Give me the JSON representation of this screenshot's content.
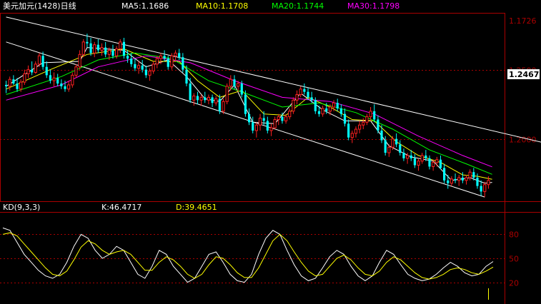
{
  "header": {
    "title": "美元加元(1428)日线",
    "ma": [
      {
        "label": "MA5:1.1686",
        "color": "#ffffff"
      },
      {
        "label": "MA10:1.1708",
        "color": "#ffff00"
      },
      {
        "label": "MA20:1.1744",
        "color": "#00ff00"
      },
      {
        "label": "MA30:1.1798",
        "color": "#ff00ff"
      }
    ]
  },
  "kd_header": {
    "name": "KD(9,3,3)",
    "k_label": "K:46.4717",
    "d_label": "D:39.4651"
  },
  "price_axis": {
    "top_value": "1.1726",
    "ticks": [
      "1.2500",
      "1.2000"
    ],
    "current_price": "1.2467",
    "current_price_display": "1.2467"
  },
  "kd_axis": {
    "ticks": [
      "80",
      "50",
      "20"
    ]
  },
  "colors": {
    "background": "#000000",
    "frame": "#aa0000",
    "grid": "#aa0000",
    "up_candle": "#ff2020",
    "down_candle": "#00ffff",
    "channel": "#ffffff",
    "k_line": "#ffffff",
    "d_line": "#ffff00"
  },
  "chart_data": [
    {
      "type": "candlestick",
      "title": "美元加元(1428)日线",
      "ylim": [
        1.156,
        1.29
      ],
      "gridlines": [
        1.25,
        1.2
      ],
      "channel": {
        "upper": [
          [
            0,
            1.288
          ],
          [
            148,
            1.196
          ]
        ],
        "lower": [
          [
            0,
            1.27
          ],
          [
            130,
            1.158
          ]
        ]
      },
      "candles": [
        [
          1.239,
          1.242,
          1.233,
          1.238
        ],
        [
          1.238,
          1.245,
          1.235,
          1.243
        ],
        [
          1.243,
          1.246,
          1.239,
          1.24
        ],
        [
          1.24,
          1.244,
          1.234,
          1.236
        ],
        [
          1.236,
          1.243,
          1.234,
          1.241
        ],
        [
          1.241,
          1.25,
          1.239,
          1.247
        ],
        [
          1.247,
          1.253,
          1.244,
          1.25
        ],
        [
          1.25,
          1.256,
          1.246,
          1.248
        ],
        [
          1.248,
          1.256,
          1.247,
          1.254
        ],
        [
          1.254,
          1.262,
          1.252,
          1.26
        ],
        [
          1.26,
          1.263,
          1.25,
          1.252
        ],
        [
          1.252,
          1.256,
          1.244,
          1.246
        ],
        [
          1.246,
          1.25,
          1.24,
          1.242
        ],
        [
          1.242,
          1.248,
          1.238,
          1.244
        ],
        [
          1.244,
          1.247,
          1.238,
          1.24
        ],
        [
          1.24,
          1.243,
          1.236,
          1.238
        ],
        [
          1.238,
          1.242,
          1.234,
          1.236
        ],
        [
          1.236,
          1.242,
          1.234,
          1.239
        ],
        [
          1.239,
          1.248,
          1.237,
          1.246
        ],
        [
          1.246,
          1.254,
          1.244,
          1.252
        ],
        [
          1.252,
          1.264,
          1.25,
          1.261
        ],
        [
          1.261,
          1.272,
          1.259,
          1.27
        ],
        [
          1.27,
          1.276,
          1.266,
          1.269
        ],
        [
          1.269,
          1.273,
          1.26,
          1.262
        ],
        [
          1.262,
          1.27,
          1.259,
          1.268
        ],
        [
          1.268,
          1.272,
          1.262,
          1.264
        ],
        [
          1.264,
          1.269,
          1.26,
          1.266
        ],
        [
          1.266,
          1.27,
          1.259,
          1.261
        ],
        [
          1.261,
          1.266,
          1.257,
          1.264
        ],
        [
          1.264,
          1.268,
          1.258,
          1.26
        ],
        [
          1.26,
          1.267,
          1.258,
          1.265
        ],
        [
          1.265,
          1.272,
          1.262,
          1.27
        ],
        [
          1.27,
          1.273,
          1.258,
          1.26
        ],
        [
          1.26,
          1.264,
          1.255,
          1.258
        ],
        [
          1.258,
          1.262,
          1.252,
          1.254
        ],
        [
          1.254,
          1.258,
          1.249,
          1.251
        ],
        [
          1.251,
          1.256,
          1.247,
          1.253
        ],
        [
          1.253,
          1.257,
          1.248,
          1.25
        ],
        [
          1.25,
          1.253,
          1.244,
          1.246
        ],
        [
          1.246,
          1.251,
          1.242,
          1.249
        ],
        [
          1.249,
          1.256,
          1.247,
          1.254
        ],
        [
          1.254,
          1.26,
          1.251,
          1.258
        ],
        [
          1.258,
          1.262,
          1.254,
          1.26
        ],
        [
          1.26,
          1.264,
          1.256,
          1.258
        ],
        [
          1.258,
          1.26,
          1.25,
          1.252
        ],
        [
          1.252,
          1.262,
          1.25,
          1.26
        ],
        [
          1.26,
          1.264,
          1.256,
          1.262
        ],
        [
          1.262,
          1.265,
          1.257,
          1.259
        ],
        [
          1.259,
          1.262,
          1.248,
          1.25
        ],
        [
          1.25,
          1.253,
          1.238,
          1.24
        ],
        [
          1.24,
          1.244,
          1.226,
          1.228
        ],
        [
          1.228,
          1.233,
          1.224,
          1.231
        ],
        [
          1.231,
          1.234,
          1.225,
          1.228
        ],
        [
          1.228,
          1.232,
          1.224,
          1.23
        ],
        [
          1.23,
          1.234,
          1.226,
          1.228
        ],
        [
          1.228,
          1.232,
          1.225,
          1.23
        ],
        [
          1.23,
          1.232,
          1.223,
          1.226
        ],
        [
          1.226,
          1.231,
          1.224,
          1.229
        ],
        [
          1.229,
          1.232,
          1.218,
          1.22
        ],
        [
          1.22,
          1.229,
          1.218,
          1.227
        ],
        [
          1.227,
          1.24,
          1.225,
          1.238
        ],
        [
          1.238,
          1.246,
          1.235,
          1.243
        ],
        [
          1.243,
          1.246,
          1.236,
          1.238
        ],
        [
          1.238,
          1.242,
          1.234,
          1.24
        ],
        [
          1.24,
          1.242,
          1.23,
          1.232
        ],
        [
          1.232,
          1.235,
          1.216,
          1.218
        ],
        [
          1.218,
          1.222,
          1.21,
          1.212
        ],
        [
          1.212,
          1.216,
          1.204,
          1.206
        ],
        [
          1.206,
          1.212,
          1.201,
          1.21
        ],
        [
          1.21,
          1.218,
          1.206,
          1.215
        ],
        [
          1.215,
          1.22,
          1.21,
          1.213
        ],
        [
          1.213,
          1.216,
          1.204,
          1.206
        ],
        [
          1.206,
          1.211,
          1.202,
          1.208
        ],
        [
          1.208,
          1.216,
          1.207,
          1.214
        ],
        [
          1.214,
          1.218,
          1.21,
          1.216
        ],
        [
          1.216,
          1.219,
          1.211,
          1.213
        ],
        [
          1.213,
          1.218,
          1.211,
          1.216
        ],
        [
          1.216,
          1.222,
          1.214,
          1.22
        ],
        [
          1.22,
          1.23,
          1.218,
          1.228
        ],
        [
          1.228,
          1.235,
          1.225,
          1.232
        ],
        [
          1.232,
          1.238,
          1.23,
          1.236
        ],
        [
          1.236,
          1.24,
          1.232,
          1.234
        ],
        [
          1.234,
          1.237,
          1.228,
          1.23
        ],
        [
          1.23,
          1.234,
          1.226,
          1.228
        ],
        [
          1.228,
          1.23,
          1.218,
          1.22
        ],
        [
          1.22,
          1.224,
          1.216,
          1.218
        ],
        [
          1.218,
          1.224,
          1.216,
          1.222
        ],
        [
          1.222,
          1.226,
          1.218,
          1.22
        ],
        [
          1.22,
          1.225,
          1.217,
          1.223
        ],
        [
          1.223,
          1.228,
          1.22,
          1.226
        ],
        [
          1.226,
          1.229,
          1.22,
          1.222
        ],
        [
          1.222,
          1.225,
          1.216,
          1.218
        ],
        [
          1.218,
          1.222,
          1.209,
          1.211
        ],
        [
          1.211,
          1.214,
          1.199,
          1.201
        ],
        [
          1.201,
          1.206,
          1.197,
          1.204
        ],
        [
          1.204,
          1.209,
          1.201,
          1.207
        ],
        [
          1.207,
          1.213,
          1.204,
          1.21
        ],
        [
          1.21,
          1.215,
          1.207,
          1.212
        ],
        [
          1.212,
          1.218,
          1.21,
          1.216
        ],
        [
          1.216,
          1.223,
          1.213,
          1.22
        ],
        [
          1.22,
          1.225,
          1.212,
          1.214
        ],
        [
          1.214,
          1.217,
          1.204,
          1.206
        ],
        [
          1.206,
          1.21,
          1.197,
          1.199
        ],
        [
          1.199,
          1.202,
          1.188,
          1.19
        ],
        [
          1.19,
          1.196,
          1.187,
          1.194
        ],
        [
          1.194,
          1.202,
          1.192,
          1.2
        ],
        [
          1.2,
          1.204,
          1.194,
          1.196
        ],
        [
          1.196,
          1.199,
          1.188,
          1.19
        ],
        [
          1.19,
          1.193,
          1.184,
          1.186
        ],
        [
          1.186,
          1.19,
          1.182,
          1.188
        ],
        [
          1.188,
          1.192,
          1.184,
          1.186
        ],
        [
          1.186,
          1.189,
          1.179,
          1.181
        ],
        [
          1.181,
          1.186,
          1.177,
          1.184
        ],
        [
          1.184,
          1.19,
          1.182,
          1.188
        ],
        [
          1.188,
          1.192,
          1.184,
          1.186
        ],
        [
          1.186,
          1.188,
          1.178,
          1.18
        ],
        [
          1.18,
          1.185,
          1.177,
          1.183
        ],
        [
          1.183,
          1.187,
          1.18,
          1.185
        ],
        [
          1.185,
          1.188,
          1.178,
          1.179
        ],
        [
          1.179,
          1.182,
          1.168,
          1.17
        ],
        [
          1.17,
          1.174,
          1.164,
          1.168
        ],
        [
          1.168,
          1.173,
          1.166,
          1.171
        ],
        [
          1.171,
          1.175,
          1.168,
          1.17
        ],
        [
          1.17,
          1.174,
          1.166,
          1.172
        ],
        [
          1.172,
          1.176,
          1.168,
          1.17
        ],
        [
          1.17,
          1.174,
          1.167,
          1.172
        ],
        [
          1.172,
          1.178,
          1.17,
          1.176
        ],
        [
          1.176,
          1.179,
          1.17,
          1.172
        ],
        [
          1.172,
          1.175,
          1.164,
          1.166
        ],
        [
          1.166,
          1.17,
          1.159,
          1.162
        ],
        [
          1.162,
          1.169,
          1.158,
          1.167
        ],
        [
          1.167,
          1.173,
          1.164,
          1.17
        ]
      ],
      "ma_lines": {
        "MA5": [
          [
            0,
            1.238
          ],
          [
            10,
            1.255
          ],
          [
            20,
            1.256
          ],
          [
            22,
            1.266
          ],
          [
            32,
            1.264
          ],
          [
            38,
            1.252
          ],
          [
            44,
            1.257
          ],
          [
            49,
            1.245
          ],
          [
            54,
            1.229
          ],
          [
            58,
            1.227
          ],
          [
            62,
            1.239
          ],
          [
            67,
            1.212
          ],
          [
            73,
            1.211
          ],
          [
            80,
            1.233
          ],
          [
            86,
            1.221
          ],
          [
            92,
            1.213
          ],
          [
            99,
            1.213
          ],
          [
            104,
            1.195
          ],
          [
            110,
            1.187
          ],
          [
            116,
            1.184
          ],
          [
            121,
            1.17
          ],
          [
            126,
            1.172
          ],
          [
            130,
            1.168
          ],
          [
            132,
            1.1686
          ]
        ],
        "MA10": [
          [
            0,
            1.236
          ],
          [
            12,
            1.25
          ],
          [
            22,
            1.261
          ],
          [
            32,
            1.265
          ],
          [
            40,
            1.256
          ],
          [
            47,
            1.256
          ],
          [
            52,
            1.242
          ],
          [
            58,
            1.23
          ],
          [
            64,
            1.235
          ],
          [
            70,
            1.218
          ],
          [
            76,
            1.217
          ],
          [
            82,
            1.23
          ],
          [
            88,
            1.223
          ],
          [
            94,
            1.214
          ],
          [
            100,
            1.213
          ],
          [
            106,
            1.198
          ],
          [
            112,
            1.188
          ],
          [
            118,
            1.183
          ],
          [
            124,
            1.174
          ],
          [
            128,
            1.173
          ],
          [
            132,
            1.1708
          ]
        ],
        "MA20": [
          [
            0,
            1.232
          ],
          [
            15,
            1.245
          ],
          [
            25,
            1.257
          ],
          [
            35,
            1.262
          ],
          [
            45,
            1.258
          ],
          [
            55,
            1.242
          ],
          [
            65,
            1.233
          ],
          [
            75,
            1.223
          ],
          [
            85,
            1.226
          ],
          [
            95,
            1.219
          ],
          [
            105,
            1.207
          ],
          [
            115,
            1.192
          ],
          [
            125,
            1.182
          ],
          [
            132,
            1.1744
          ]
        ],
        "MA30": [
          [
            0,
            1.228
          ],
          [
            15,
            1.239
          ],
          [
            25,
            1.252
          ],
          [
            38,
            1.26
          ],
          [
            50,
            1.255
          ],
          [
            62,
            1.242
          ],
          [
            75,
            1.23
          ],
          [
            88,
            1.227
          ],
          [
            100,
            1.218
          ],
          [
            112,
            1.202
          ],
          [
            124,
            1.188
          ],
          [
            132,
            1.1798
          ]
        ]
      }
    },
    {
      "type": "line",
      "title": "KD(9,3,3)",
      "ylim": [
        0,
        100
      ],
      "gridlines": [
        80,
        50,
        20
      ],
      "series": [
        {
          "name": "K",
          "values": [
            88,
            85,
            70,
            55,
            45,
            35,
            28,
            25,
            30,
            45,
            65,
            80,
            75,
            60,
            50,
            55,
            65,
            60,
            45,
            30,
            25,
            40,
            60,
            55,
            40,
            30,
            20,
            25,
            40,
            55,
            58,
            45,
            30,
            22,
            20,
            30,
            55,
            75,
            85,
            80,
            60,
            42,
            28,
            22,
            25,
            38,
            52,
            60,
            55,
            40,
            28,
            22,
            28,
            45,
            60,
            55,
            42,
            30,
            25,
            22,
            24,
            30,
            38,
            45,
            40,
            32,
            28,
            30,
            40,
            46
          ]
        },
        {
          "name": "D",
          "values": [
            80,
            82,
            78,
            68,
            58,
            48,
            38,
            30,
            28,
            34,
            48,
            64,
            72,
            68,
            60,
            55,
            58,
            60,
            55,
            45,
            35,
            35,
            45,
            52,
            48,
            40,
            30,
            25,
            30,
            42,
            52,
            50,
            42,
            32,
            26,
            26,
            38,
            55,
            72,
            80,
            72,
            58,
            45,
            34,
            28,
            30,
            40,
            50,
            54,
            48,
            38,
            30,
            28,
            34,
            45,
            52,
            48,
            40,
            32,
            26,
            24,
            26,
            30,
            36,
            38,
            36,
            32,
            30,
            34,
            39
          ]
        }
      ]
    }
  ]
}
